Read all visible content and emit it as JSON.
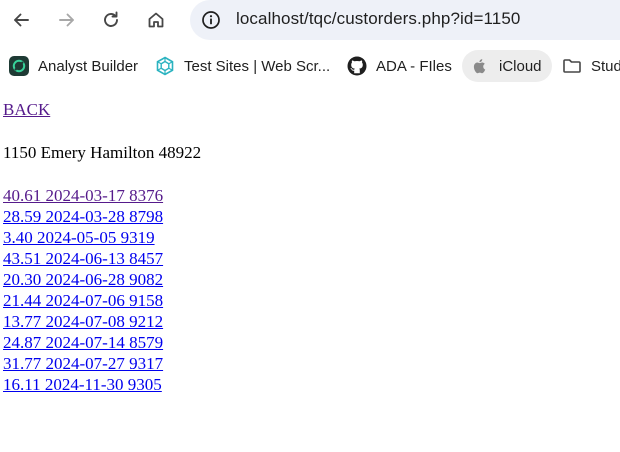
{
  "browser": {
    "url": "localhost/tqc/custorders.php?id=1150",
    "icons": {
      "back": "arrow-left-icon",
      "forward": "arrow-right-icon",
      "reload": "reload-icon",
      "home": "home-icon",
      "site_info": "site-info-icon"
    },
    "bookmarks": [
      {
        "label": "Analyst Builder",
        "icon": "analyst-builder-favicon"
      },
      {
        "label": "Test Sites | Web Scr...",
        "icon": "test-sites-favicon"
      },
      {
        "label": "ADA - FIles",
        "icon": "github-icon"
      },
      {
        "label": "iCloud",
        "icon": "apple-icon"
      },
      {
        "label": "Stud",
        "icon": "folder-icon"
      }
    ]
  },
  "page": {
    "back_label": "BACK",
    "customer_line": "1150 Emery Hamilton 48922",
    "orders": [
      {
        "text": "40.61 2024-03-17 8376",
        "visited": true
      },
      {
        "text": "28.59 2024-03-28 8798",
        "visited": false
      },
      {
        "text": "3.40 2024-05-05 9319",
        "visited": false
      },
      {
        "text": "43.51 2024-06-13 8457",
        "visited": false
      },
      {
        "text": "20.30 2024-06-28 9082",
        "visited": false
      },
      {
        "text": "21.44 2024-07-06 9158",
        "visited": false
      },
      {
        "text": "13.77 2024-07-08 9212",
        "visited": false
      },
      {
        "text": "24.87 2024-07-14 8579",
        "visited": false
      },
      {
        "text": "31.77 2024-07-27 9317",
        "visited": false
      },
      {
        "text": "16.11 2024-11-30 9305",
        "visited": false
      }
    ]
  },
  "colors": {
    "link": "#0000ee",
    "visited_link": "#551a8b",
    "omnibox_bg": "#eef1f8"
  }
}
